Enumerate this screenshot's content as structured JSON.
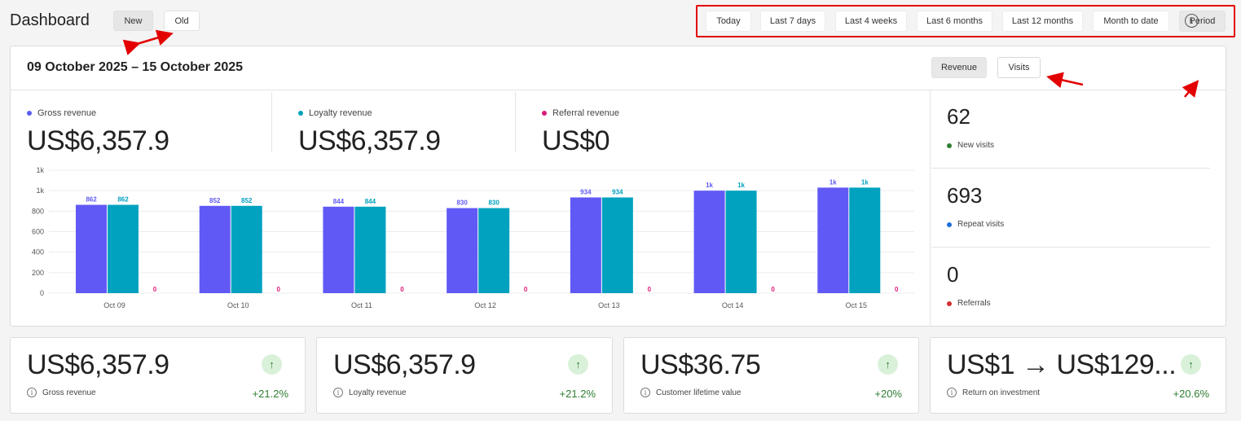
{
  "header": {
    "title": "Dashboard",
    "toggle_new": "New",
    "toggle_old": "Old"
  },
  "periods": [
    "Today",
    "Last 7 days",
    "Last 4 weeks",
    "Last 6 months",
    "Last 12 months",
    "Month to date",
    "Period"
  ],
  "active_period": "Period",
  "main": {
    "date_range": "09 October 2025 – 15 October 2025",
    "mode_revenue": "Revenue",
    "mode_visits": "Visits",
    "info_glyph": "i",
    "metrics": [
      {
        "label": "Gross revenue",
        "value": "US$6,357.9",
        "color": "#5b5cf0"
      },
      {
        "label": "Loyalty revenue",
        "value": "US$6,357.9",
        "color": "#00a0b8"
      },
      {
        "label": "Referral revenue",
        "value": "US$0",
        "color": "#d81b7a"
      }
    ],
    "side": [
      {
        "value": "62",
        "label": "New visits",
        "color": "#2e7d32"
      },
      {
        "value": "693",
        "label": "Repeat visits",
        "color": "#1e6fd9"
      },
      {
        "value": "0",
        "label": "Referrals",
        "color": "#d32f2f"
      }
    ]
  },
  "chart_data": {
    "type": "bar",
    "categories": [
      "Oct 09",
      "Oct 10",
      "Oct 11",
      "Oct 12",
      "Oct 13",
      "Oct 14",
      "Oct 15"
    ],
    "series": [
      {
        "name": "Gross revenue",
        "values": [
          862,
          852,
          844,
          830,
          934,
          1000,
          1030
        ],
        "labels": [
          "862",
          "852",
          "844",
          "830",
          "934",
          "1k",
          "1k"
        ],
        "color": "#6159f5"
      },
      {
        "name": "Loyalty revenue",
        "values": [
          862,
          852,
          844,
          830,
          934,
          1000,
          1030
        ],
        "labels": [
          "862",
          "852",
          "844",
          "830",
          "934",
          "1k",
          "1k"
        ],
        "color": "#00a2bf"
      },
      {
        "name": "Referral revenue",
        "values": [
          0,
          0,
          0,
          0,
          0,
          0,
          0
        ],
        "labels": [
          "0",
          "0",
          "0",
          "0",
          "0",
          "0",
          "0"
        ],
        "color": "#d81b7a"
      }
    ],
    "y_ticks": [
      0,
      200,
      400,
      600,
      800,
      1000,
      1200
    ],
    "y_tick_labels": [
      "0",
      "200",
      "400",
      "600",
      "800",
      "1k",
      "1k"
    ],
    "ylim": [
      0,
      1200
    ],
    "grid": true
  },
  "kpis": [
    {
      "value": "US$6,357.9",
      "label": "Gross revenue",
      "change": "+21.2%",
      "icon": "arrow-up-icon",
      "arrow": "↑",
      "info": "i"
    },
    {
      "value": "US$6,357.9",
      "label": "Loyalty revenue",
      "change": "+21.2%",
      "icon": "arrow-up-icon",
      "arrow": "↑",
      "info": "i"
    },
    {
      "value": "US$36.75",
      "label": "Customer lifetime value",
      "change": "+20%",
      "icon": "arrow-up-icon",
      "arrow": "↑",
      "info": "i"
    },
    {
      "value": "US$1 → US$129...",
      "label": "Return on investment",
      "change": "+20.6%",
      "icon": "arrow-up-icon",
      "arrow": "↑",
      "info": "i"
    }
  ],
  "colors": {
    "annotation": "#e30000",
    "positive": "#2e7d32"
  }
}
